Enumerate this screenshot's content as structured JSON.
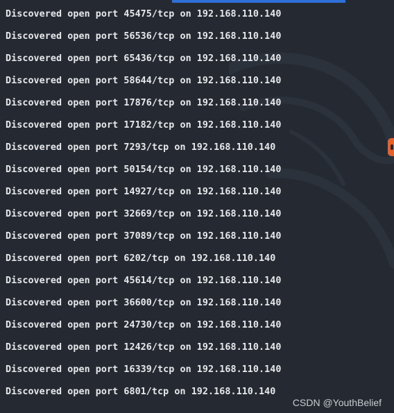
{
  "terminal": {
    "lines": [
      "Discovered open port 45475/tcp on 192.168.110.140",
      "Discovered open port 56536/tcp on 192.168.110.140",
      "Discovered open port 65436/tcp on 192.168.110.140",
      "Discovered open port 58644/tcp on 192.168.110.140",
      "Discovered open port 17876/tcp on 192.168.110.140",
      "Discovered open port 17182/tcp on 192.168.110.140",
      "Discovered open port 7293/tcp on 192.168.110.140",
      "Discovered open port 50154/tcp on 192.168.110.140",
      "Discovered open port 14927/tcp on 192.168.110.140",
      "Discovered open port 32669/tcp on 192.168.110.140",
      "Discovered open port 37089/tcp on 192.168.110.140",
      "Discovered open port 6202/tcp on 192.168.110.140",
      "Discovered open port 45614/tcp on 192.168.110.140",
      "Discovered open port 36600/tcp on 192.168.110.140",
      "Discovered open port 24730/tcp on 192.168.110.140",
      "Discovered open port 12426/tcp on 192.168.110.140",
      "Discovered open port 16339/tcp on 192.168.110.140",
      "Discovered open port 6801/tcp on 192.168.110.140"
    ]
  },
  "watermark": {
    "text": "CSDN @YouthBelief"
  },
  "colors": {
    "background": "#252a32",
    "text": "#e6e8eb",
    "tab_accent": "#2f6fd8",
    "edge_marker": "#e8612c",
    "watermark": "#c9ccd1"
  },
  "icons": {
    "background_art": "kali-dragon-icon"
  }
}
